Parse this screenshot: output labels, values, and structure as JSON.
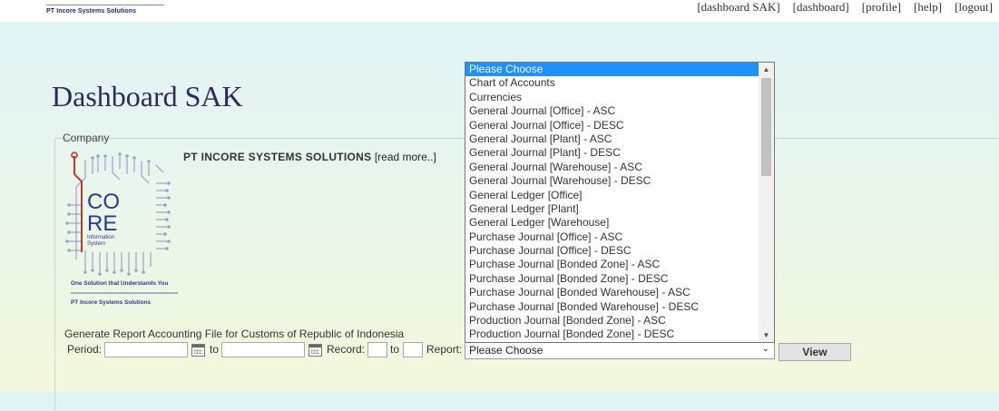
{
  "header": {
    "brand": "PT Incore Systems Solutions",
    "nav": [
      "[dashboard SAK]",
      "[dashboard]",
      "[profile]",
      "[help]",
      "[logout]"
    ]
  },
  "page": {
    "title": "Dashboard SAK"
  },
  "company": {
    "legend": "Company",
    "name": "PT INCORE SYSTEMS SOLUTIONS",
    "read_more": "[read more..]",
    "logo": {
      "core_top": "CO",
      "core_bottom": "RE",
      "subtitle1": "Information",
      "subtitle2": "System",
      "tagline": "One Solution that Understands You",
      "company": "PT Incore Systems Solutions"
    }
  },
  "report": {
    "heading": "Generate Report Accounting File for Customs of Republic of Indonesia",
    "period_label": "Period:",
    "to_label": "to",
    "record_label": "Record:",
    "record_to_label": "to",
    "report_label": "Report:",
    "period_from": "",
    "period_to": "",
    "record_from": "",
    "record_to": "",
    "selected": "Please Choose",
    "view_button": "View",
    "options": [
      "Please Choose",
      "Chart of Accounts",
      "Currencies",
      "General Journal [Office] - ASC",
      "General Journal [Office] - DESC",
      "General Journal [Plant] - ASC",
      "General Journal [Plant] - DESC",
      "General Journal [Warehouse] - ASC",
      "General Journal [Warehouse] - DESC",
      "General Ledger [Office]",
      "General Ledger [Plant]",
      "General Ledger [Warehouse]",
      "Purchase Journal [Office] - ASC",
      "Purchase Journal [Office] - DESC",
      "Purchase Journal [Bonded Zone] - ASC",
      "Purchase Journal [Bonded Zone] - DESC",
      "Purchase Journal [Bonded Warehouse] - ASC",
      "Purchase Journal [Bonded Warehouse] - DESC",
      "Production Journal [Bonded Zone] - ASC",
      "Production Journal [Bonded Zone] - DESC"
    ]
  },
  "colors": {
    "title": "#2e2a5a",
    "brand": "#1a2a6c",
    "selection": "#1e90ff",
    "logo_red": "#c0392b",
    "logo_blue": "#2b3a8c"
  },
  "icons": [
    "calendar-icon",
    "chevron-down-icon",
    "scroll-up-icon",
    "scroll-down-icon"
  ]
}
